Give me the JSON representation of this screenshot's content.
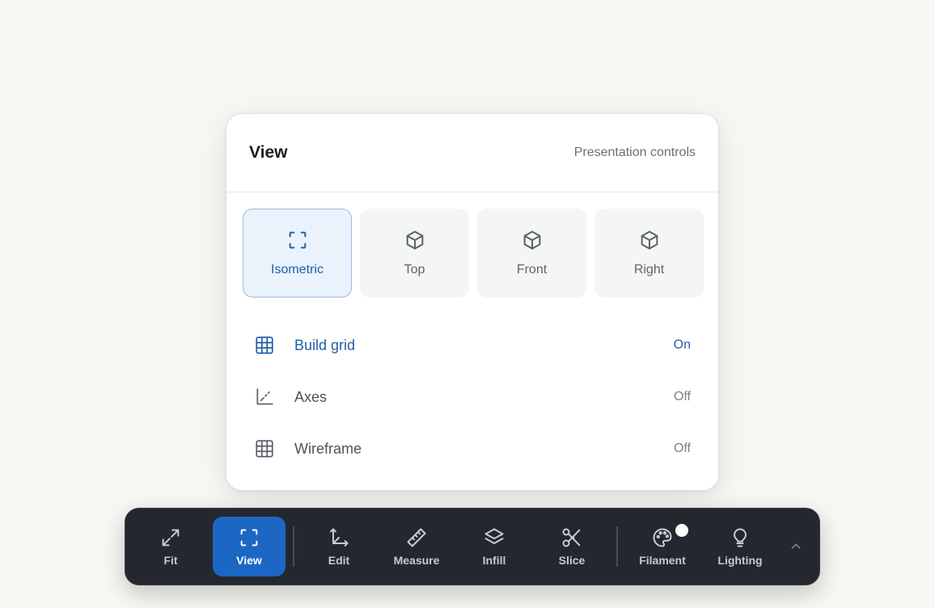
{
  "panel": {
    "title": "View",
    "subtitle": "Presentation controls",
    "views": [
      {
        "label": "Isometric",
        "icon": "focus-frame-icon",
        "active": true
      },
      {
        "label": "Top",
        "icon": "cube-icon",
        "active": false
      },
      {
        "label": "Front",
        "icon": "cube-icon",
        "active": false
      },
      {
        "label": "Right",
        "icon": "cube-icon",
        "active": false
      }
    ],
    "toggles": [
      {
        "label": "Build grid",
        "state": "On",
        "icon": "grid-icon"
      },
      {
        "label": "Axes",
        "state": "Off",
        "icon": "axes-icon"
      },
      {
        "label": "Wireframe",
        "state": "Off",
        "icon": "wireframe-icon"
      }
    ]
  },
  "toolbar": {
    "tools": [
      {
        "label": "Fit",
        "icon": "expand-icon"
      },
      {
        "label": "View",
        "icon": "focus-frame-icon",
        "active": true
      },
      {
        "label": "Edit",
        "icon": "move-axes-icon"
      },
      {
        "label": "Measure",
        "icon": "ruler-icon"
      },
      {
        "label": "Infill",
        "icon": "layers-icon"
      },
      {
        "label": "Slice",
        "icon": "scissors-icon"
      },
      {
        "label": "Filament",
        "icon": "palette-icon"
      },
      {
        "label": "Lighting",
        "icon": "lightbulb-icon"
      }
    ],
    "more_icon": "chevron-up-icon"
  },
  "colors": {
    "accent": "#1d67c4",
    "accent_text": "#1f5fa8",
    "toolbar_bg": "#24272d",
    "page_bg": "#f7f7f3"
  }
}
